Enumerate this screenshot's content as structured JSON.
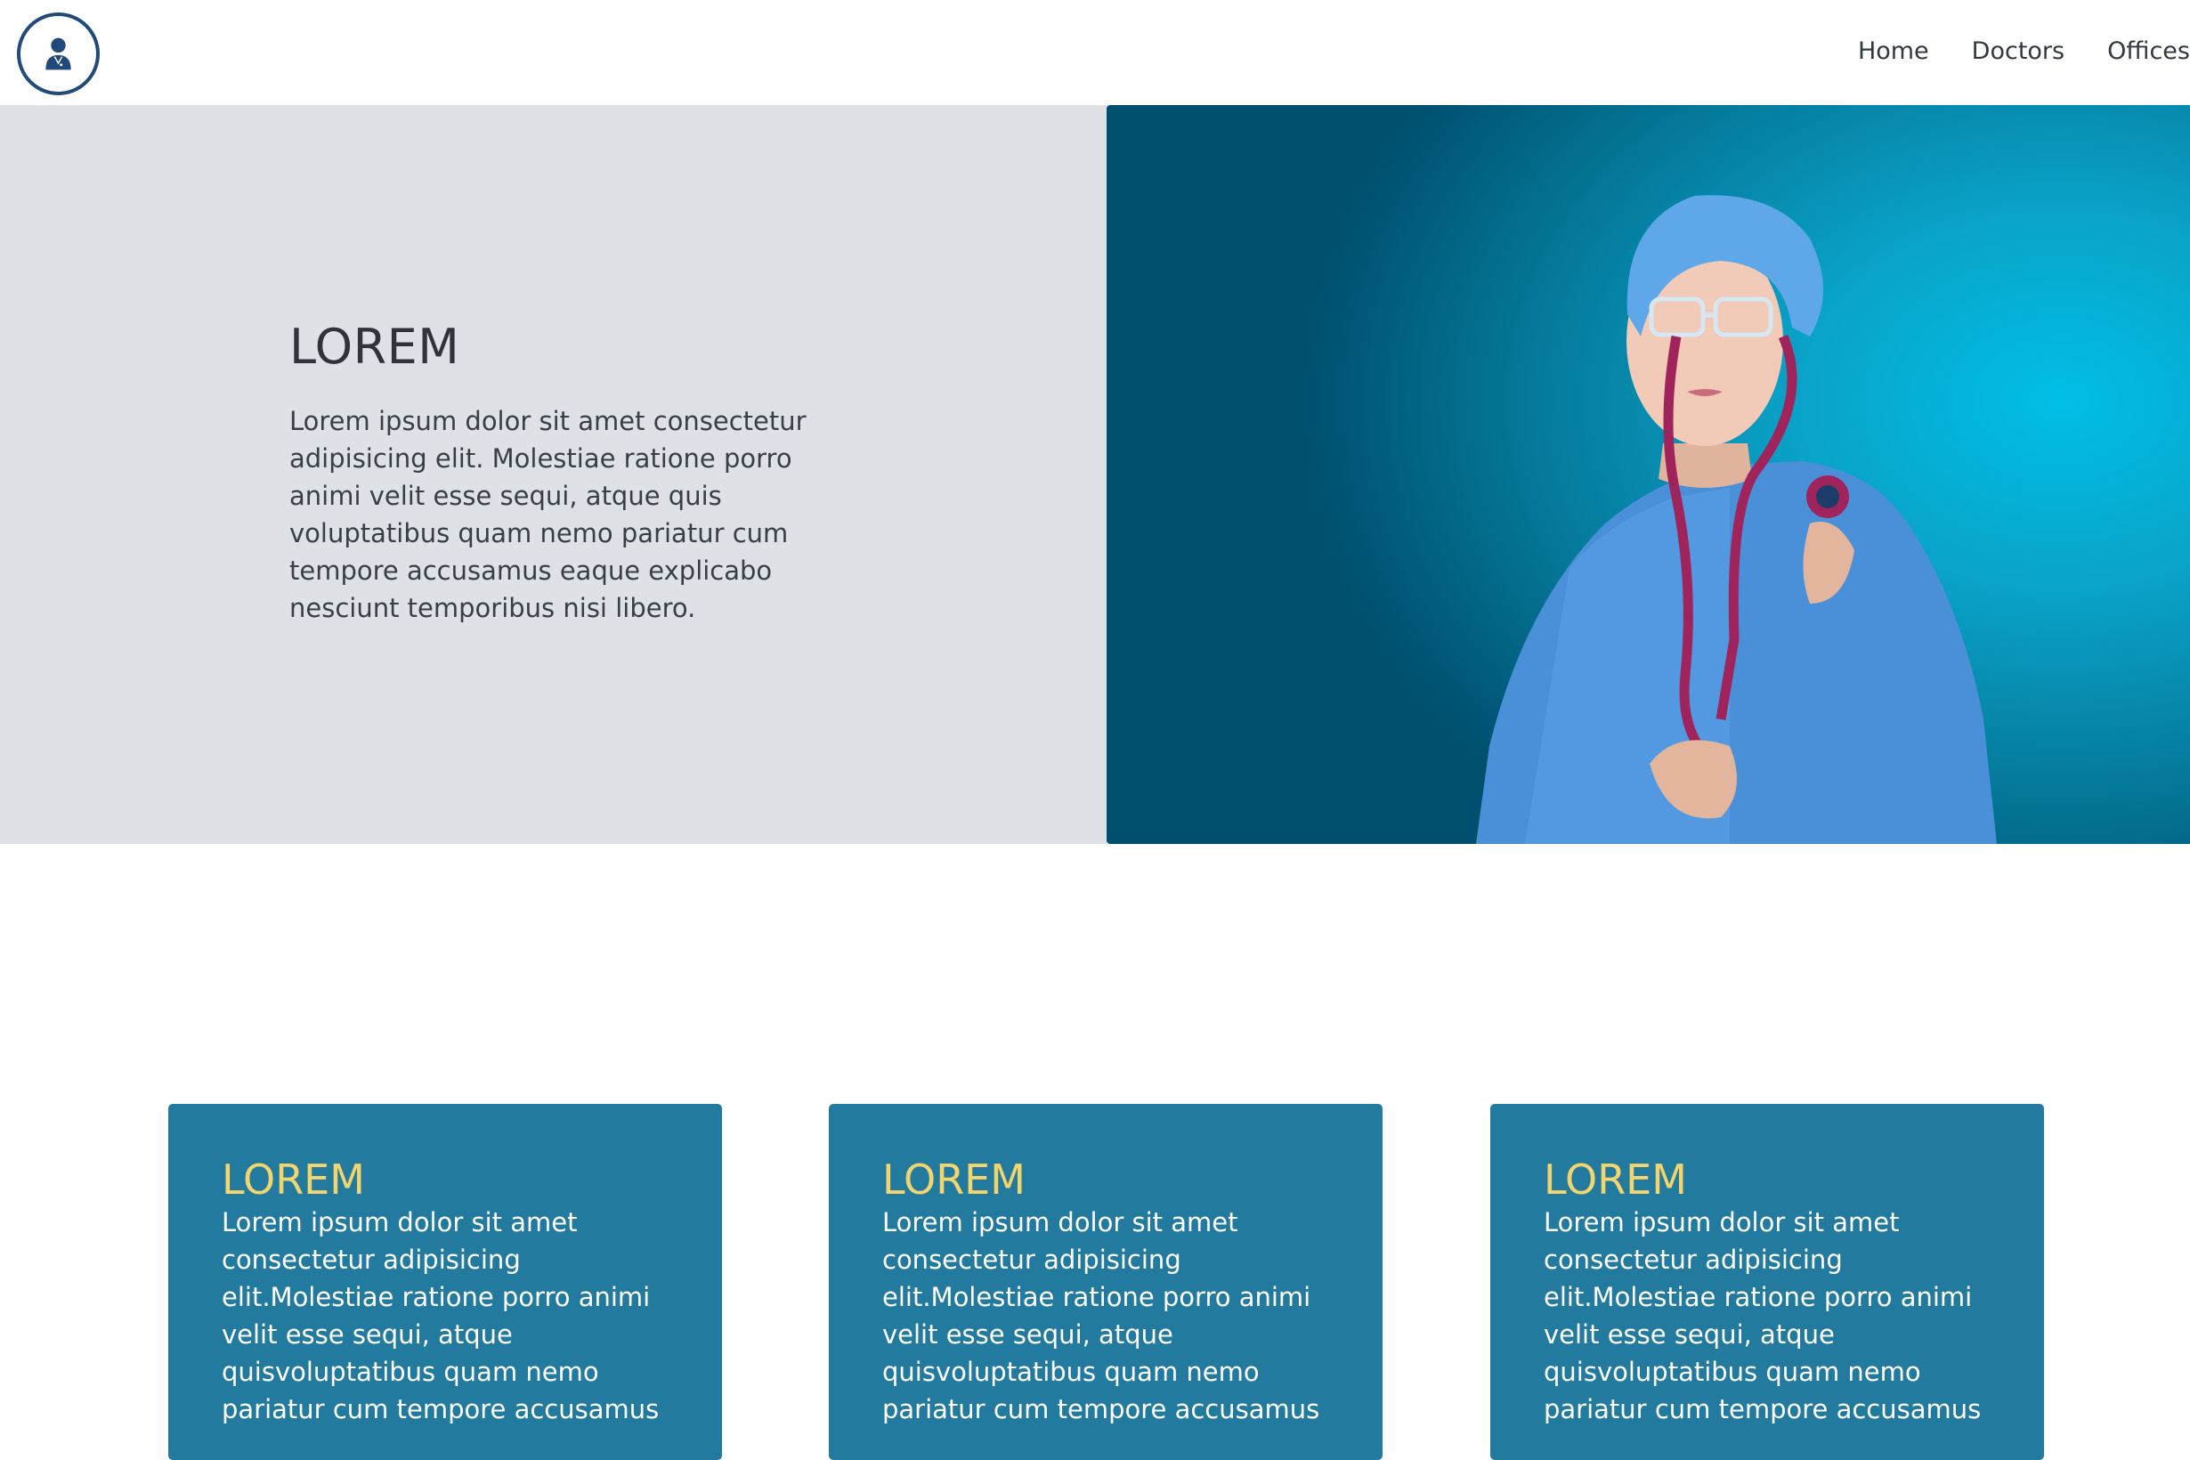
{
  "header": {
    "logo_icon": "doctor-avatar-icon",
    "nav": [
      {
        "label": "Home"
      },
      {
        "label": "Doctors"
      },
      {
        "label": "Offices"
      }
    ]
  },
  "hero": {
    "title": "LOREM",
    "text": "Lorem ipsum dolor sit amet consectetur adipisicing elit. Molestiae ratione porro animi velit esse sequi, atque quis voluptatibus quam nemo pariatur cum tempore accusamus eaque explicabo nesciunt temporibus nisi libero.",
    "image": "doctor-with-stethoscope-photo"
  },
  "cards": [
    {
      "title": "LOREM",
      "text": "Lorem ipsum dolor sit amet consectetur adipisicing elit.Molestiae ratione porro animi velit esse sequi, atque quisvoluptatibus quam nemo pariatur cum tempore accusamus"
    },
    {
      "title": "LOREM",
      "text": "Lorem ipsum dolor sit amet consectetur adipisicing elit.Molestiae ratione porro animi velit esse sequi, atque quisvoluptatibus quam nemo pariatur cum tempore accusamus"
    },
    {
      "title": "LOREM",
      "text": "Lorem ipsum dolor sit amet consectetur adipisicing elit.Molestiae ratione porro animi velit esse sequi, atque quisvoluptatibus quam nemo pariatur cum tempore accusamus"
    }
  ],
  "colors": {
    "brand_navy": "#1f4a7a",
    "hero_bg": "#dee1e6",
    "card_bg": "#237a9f",
    "card_title": "#f3d56e",
    "photo_teal": "#0aa2c8"
  }
}
